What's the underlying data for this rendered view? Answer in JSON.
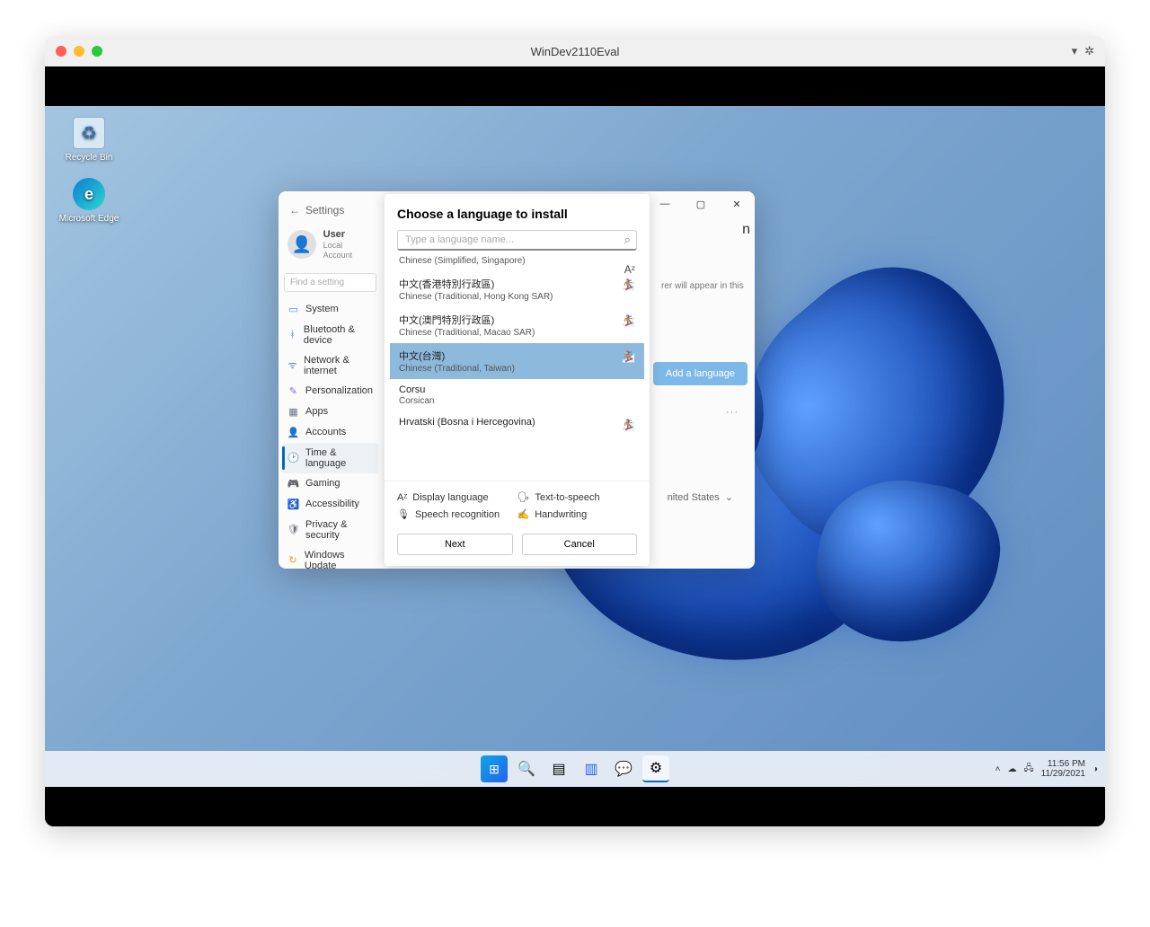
{
  "mac": {
    "title": "WinDev2110Eval",
    "dropdown": "▾",
    "gear": "✲"
  },
  "desktop": {
    "recycle": "Recycle Bin",
    "edge": "Microsoft Edge"
  },
  "settings": {
    "back_label": "Settings",
    "user": {
      "name": "User",
      "sub": "Local Account",
      "avatar": "◯"
    },
    "search_placeholder": "Find a setting",
    "nav": {
      "system": "System",
      "bluetooth": "Bluetooth & device",
      "network": "Network & internet",
      "personalization": "Personalization",
      "apps": "Apps",
      "accounts": "Accounts",
      "time": "Time & language",
      "gaming": "Gaming",
      "accessibility": "Accessibility",
      "privacy": "Privacy & security",
      "update": "Windows Update"
    },
    "main": {
      "header_fragment": "n",
      "descr_fragment": "rer will appear in this",
      "add_language": "Add a language",
      "more": "···",
      "region_fragment": "nited States",
      "chev": "⌄"
    }
  },
  "modal": {
    "title": "Choose a language to install",
    "search_placeholder": "Type a language name...",
    "items": [
      {
        "native": "",
        "eng": "Chinese (Simplified, Singapore)",
        "feat": "Aᶻ",
        "partial": true
      },
      {
        "native": "中文(香港特別行政區)",
        "eng": "Chinese (Traditional, Hong Kong SAR)",
        "feat": "🏂"
      },
      {
        "native": "中文(澳門特別行政區)",
        "eng": "Chinese (Traditional, Macao SAR)",
        "feat": "🏂"
      },
      {
        "native": "中文(台灣)",
        "eng": "Chinese (Traditional, Taiwan)",
        "feat": "🏂",
        "selected": true
      },
      {
        "native": "Corsu",
        "eng": "Corsican",
        "feat": ""
      },
      {
        "native": "Hrvatski (Bosna i Hercegovina)",
        "eng": "",
        "feat": "🏂"
      }
    ],
    "features": {
      "display": "Display language",
      "tts": "Text-to-speech",
      "speech": "Speech recognition",
      "hand": "Handwriting"
    },
    "next": "Next",
    "cancel": "Cancel"
  },
  "taskbar": {
    "time": "11:56 PM",
    "date": "11/29/2021"
  }
}
